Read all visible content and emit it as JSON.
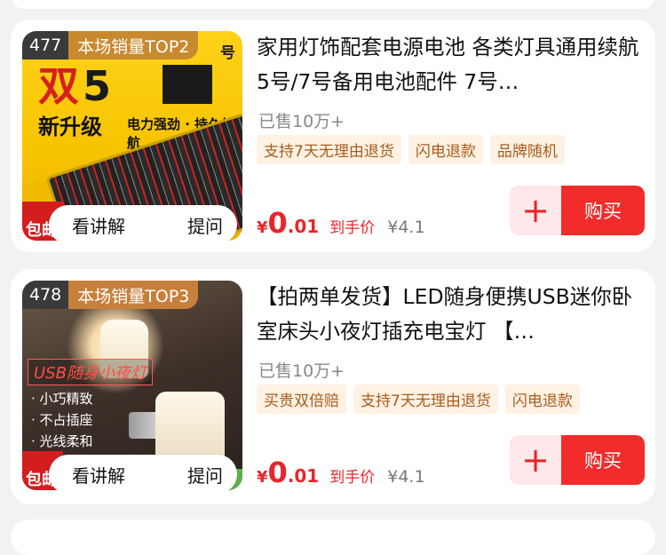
{
  "products": [
    {
      "rank": "477",
      "rank_label": "本场销量TOP2",
      "thumb_side_text": "号",
      "thumb_headline": "新升级",
      "thumb_sub": "电力强劲 · 持久续航",
      "thumb_badge": "包邮",
      "pill_explain": "看讲解",
      "pill_ask": "提问",
      "title": "家用灯饰配套电源电池 各类灯具通用续航5号/7号备用电池配件 7号…",
      "sold": "已售10万+",
      "tags": [
        "支持7天无理由退货",
        "闪电退款",
        "品牌随机"
      ],
      "price_symbol": "¥",
      "price_int": "0",
      "price_dec": ".01",
      "price_label": "到手价",
      "price_original": "¥4.1",
      "add_symbol": "+",
      "buy_label": "购买"
    },
    {
      "rank": "478",
      "rank_label": "本场销量TOP3",
      "thumb_headline": "USB随身小夜灯",
      "thumb_features": [
        "· 小巧精致",
        "· 不占插座",
        "· 光线柔和"
      ],
      "thumb_badge": "包邮",
      "pill_explain": "看讲解",
      "pill_ask": "提问",
      "title": "【拍两单发货】LED随身便携USB迷你卧室床头小夜灯插充电宝灯 【…",
      "sold": "已售10万+",
      "tags": [
        "买贵双倍赔",
        "支持7天无理由退货",
        "闪电退款"
      ],
      "price_symbol": "¥",
      "price_int": "0",
      "price_dec": ".01",
      "price_label": "到手价",
      "price_original": "¥4.1",
      "add_symbol": "+",
      "buy_label": "购买"
    }
  ],
  "colors": {
    "accent_red": "#f22b2b",
    "price_red": "#e8262a",
    "tag_bg": "#fff1e3",
    "tag_text": "#a85d1c",
    "rank_gold": "#c8892f"
  }
}
